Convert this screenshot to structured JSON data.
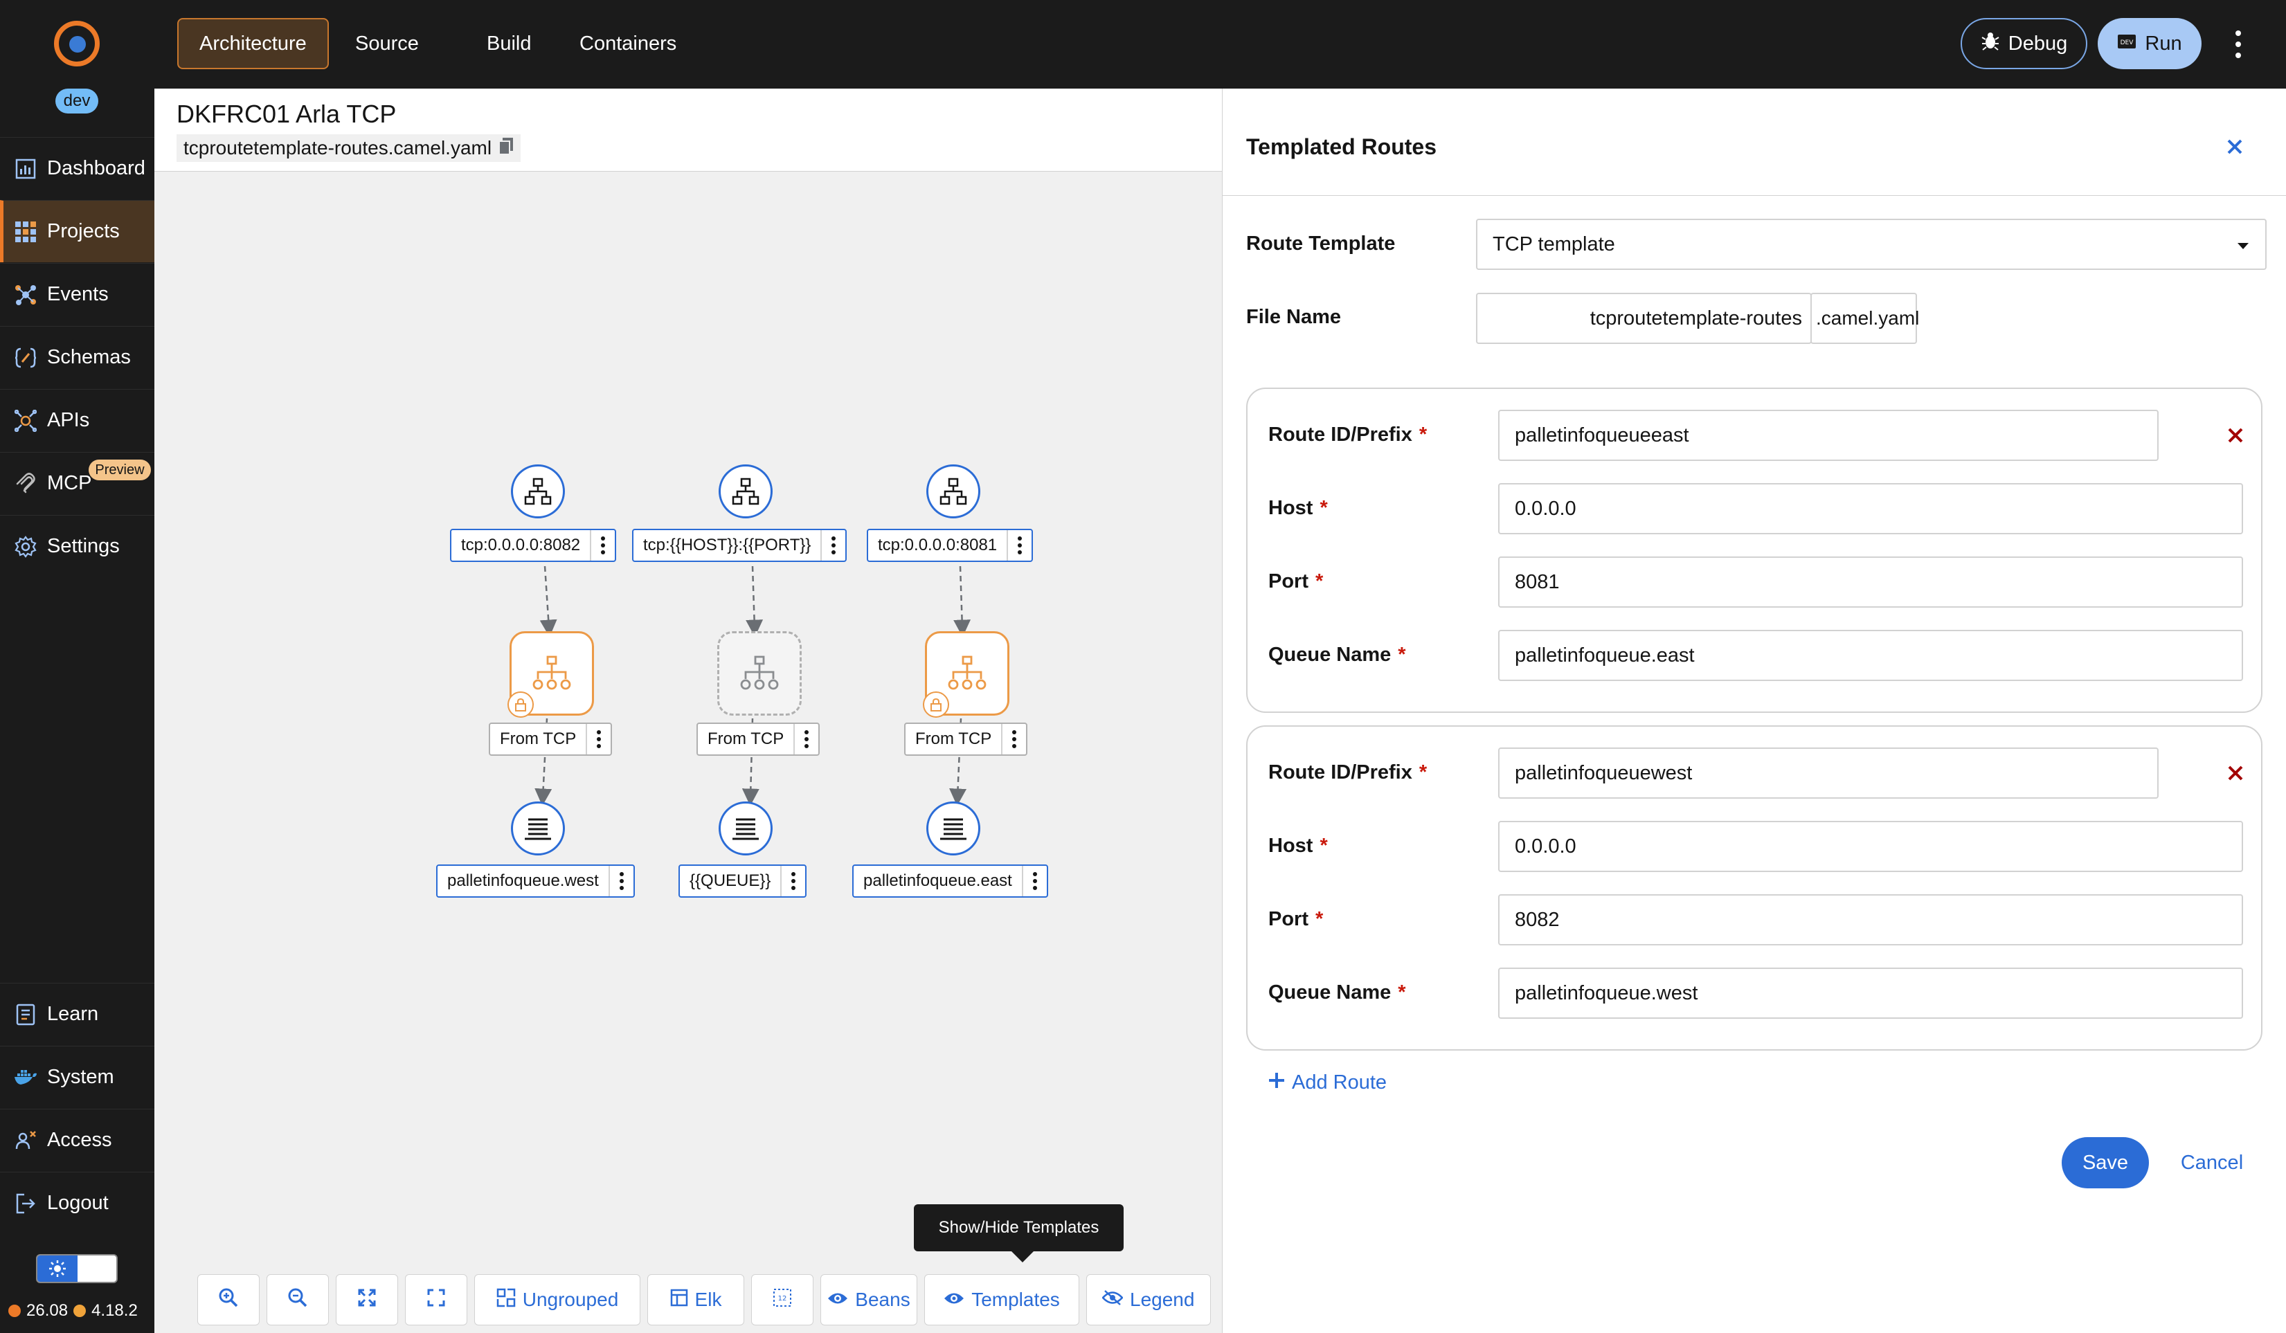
{
  "app": {
    "env_badge": "dev",
    "version_left": "26.08",
    "version_right": "4.18.2"
  },
  "sidebar": {
    "items": [
      {
        "label": "Dashboard",
        "icon": "dashboard-icon"
      },
      {
        "label": "Projects",
        "icon": "projects-grid-icon"
      },
      {
        "label": "Events",
        "icon": "events-icon"
      },
      {
        "label": "Schemas",
        "icon": "schemas-icon"
      },
      {
        "label": "APIs",
        "icon": "apis-icon"
      },
      {
        "label": "MCP",
        "icon": "mcp-icon"
      },
      {
        "label": "Settings",
        "icon": "gear-icon"
      }
    ],
    "mcp_badge": "Preview",
    "bottom_items": [
      {
        "label": "Learn",
        "icon": "learn-icon"
      },
      {
        "label": "System",
        "icon": "docker-icon"
      },
      {
        "label": "Access",
        "icon": "access-icon"
      },
      {
        "label": "Logout",
        "icon": "logout-icon"
      }
    ]
  },
  "topbar": {
    "tabs": [
      "Architecture",
      "Source",
      "Build",
      "Containers"
    ],
    "active_tab": "Architecture",
    "debug_label": "Debug",
    "run_label": "Run"
  },
  "project": {
    "title": "DKFRC01 Arla TCP",
    "file": "tcproutetemplate-routes.camel.yaml"
  },
  "diagram": {
    "columns": [
      {
        "source": "tcp:0.0.0.0:8082",
        "route": "From TCP",
        "target": "palletinfoqueue.west",
        "templated": true
      },
      {
        "source": "tcp:{{HOST}}:{{PORT}}",
        "route": "From TCP",
        "target": "{{QUEUE}}",
        "templated": false
      },
      {
        "source": "tcp:0.0.0.0:8081",
        "route": "From TCP",
        "target": "palletinfoqueue.east",
        "templated": true
      }
    ]
  },
  "toolbar": {
    "tooltip": "Show/Hide Templates",
    "ungrouped": "Ungrouped",
    "elk": "Elk",
    "beans": "Beans",
    "templates": "Templates",
    "legend": "Legend"
  },
  "drawer": {
    "title": "Templated Routes",
    "route_template_label": "Route Template",
    "route_template_value": "TCP template",
    "file_name_label": "File Name",
    "file_name_value": "tcproutetemplate-routes",
    "file_name_suffix": ".camel.yaml",
    "field_labels": {
      "route_id": "Route ID/Prefix",
      "host": "Host",
      "port": "Port",
      "queue": "Queue Name",
      "required": "*"
    },
    "routes": [
      {
        "route_id": "palletinfoqueueeast",
        "host": "0.0.0.0",
        "port": "8081",
        "queue": "palletinfoqueue.east"
      },
      {
        "route_id": "palletinfoqueuewest",
        "host": "0.0.0.0",
        "port": "8082",
        "queue": "palletinfoqueue.west"
      }
    ],
    "add_route": "Add Route",
    "save": "Save",
    "cancel": "Cancel"
  },
  "colors": {
    "accent": "#2b6cd6",
    "brand_orange": "#ec7a28",
    "danger": "#c9190b"
  }
}
